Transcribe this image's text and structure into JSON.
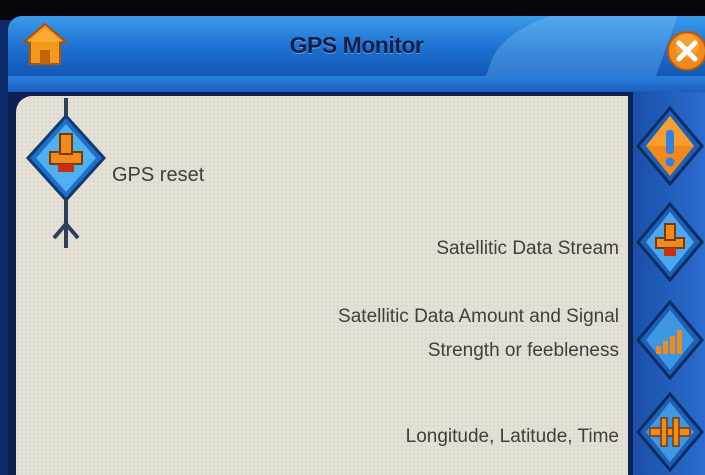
{
  "titlebar": {
    "title": "GPS Monitor",
    "home_icon": "home-icon",
    "close_icon": "close-icon"
  },
  "main": {
    "gps_reset": {
      "label": "GPS reset",
      "icon": "gps-reset-icon"
    },
    "descriptions": {
      "stream": "Satellitic Data Stream",
      "amount_line1": "Satellitic Data Amount and Signal",
      "amount_line2": "Strength or feebleness",
      "coords": "Longitude, Latitude, Time"
    }
  },
  "sidebar": {
    "buttons": [
      {
        "icon": "alert-icon"
      },
      {
        "icon": "satellite-data-stream-icon"
      },
      {
        "icon": "signal-strength-icon"
      },
      {
        "icon": "coordinates-icon"
      }
    ]
  },
  "colors": {
    "titlebar": "#2a82dc",
    "panel": "#e4e0d6",
    "text": "#3f3f3f",
    "accent_orange": "#f08a1a",
    "button_blue": "#1e6fd2"
  }
}
